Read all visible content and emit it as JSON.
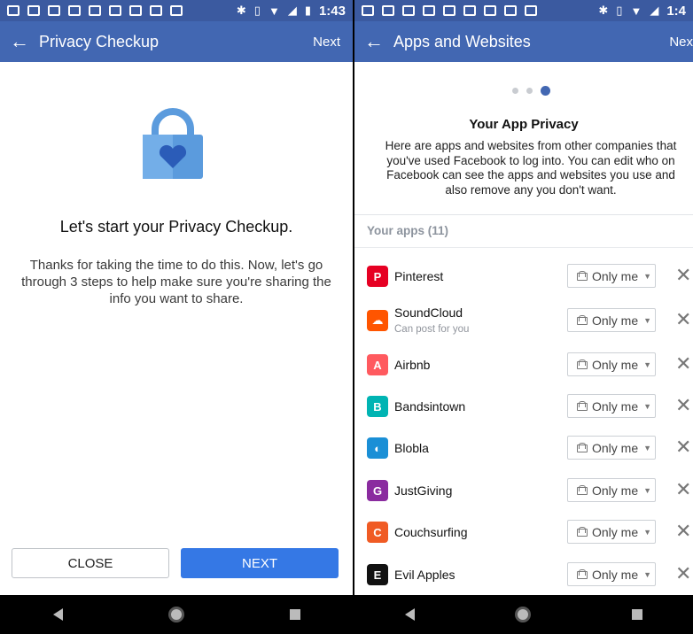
{
  "left_screen": {
    "status_time": "1:43",
    "appbar": {
      "back_icon": "arrow-left-icon",
      "title": "Privacy Checkup",
      "next": "Next"
    },
    "heading": "Let's start your Privacy Checkup.",
    "body": "Thanks for taking the time to do this. Now, let's go through 3 steps to help make sure you're sharing the info you want to share.",
    "close_button": "CLOSE",
    "next_button": "NEXT",
    "colors": {
      "appbar": "#4267b2",
      "lock": "#5b9bdd",
      "heart": "#2b5cb8",
      "primary_button": "#3578e5"
    }
  },
  "right_screen": {
    "status_time": "1:4",
    "appbar": {
      "back_icon": "arrow-left-icon",
      "title": "Apps and Websites",
      "next": "Nex"
    },
    "progress": {
      "total_steps": 3,
      "active_step": 3
    },
    "title": "Your App Privacy",
    "description": "Here are apps and websites from other companies that you've used Facebook to log into. You can edit who on Facebook can see the apps and websites you use and also remove any you don't want.",
    "section_label": "Your apps (11)",
    "apps": [
      {
        "name": "Pinterest",
        "sub": "",
        "privacy": "Only me",
        "icon_color": "#e60023",
        "icon_glyph": "P"
      },
      {
        "name": "SoundCloud",
        "sub": "Can post for you",
        "privacy": "Only me",
        "icon_color": "#ff5500",
        "icon_glyph": "☁"
      },
      {
        "name": "Airbnb",
        "sub": "",
        "privacy": "Only me",
        "icon_color": "#ff5a5f",
        "icon_glyph": "A"
      },
      {
        "name": "Bandsintown",
        "sub": "",
        "privacy": "Only me",
        "icon_color": "#00b4b3",
        "icon_glyph": "B"
      },
      {
        "name": "Blobla",
        "sub": "",
        "privacy": "Only me",
        "icon_color": "#1a8fd6",
        "icon_glyph": "◐"
      },
      {
        "name": "JustGiving",
        "sub": "",
        "privacy": "Only me",
        "icon_color": "#8a2b9f",
        "icon_glyph": "G"
      },
      {
        "name": "Couchsurfing",
        "sub": "",
        "privacy": "Only me",
        "icon_color": "#f05b24",
        "icon_glyph": "C"
      },
      {
        "name": "Evil Apples",
        "sub": "",
        "privacy": "Only me",
        "icon_color": "#111111",
        "icon_glyph": "E"
      }
    ]
  }
}
